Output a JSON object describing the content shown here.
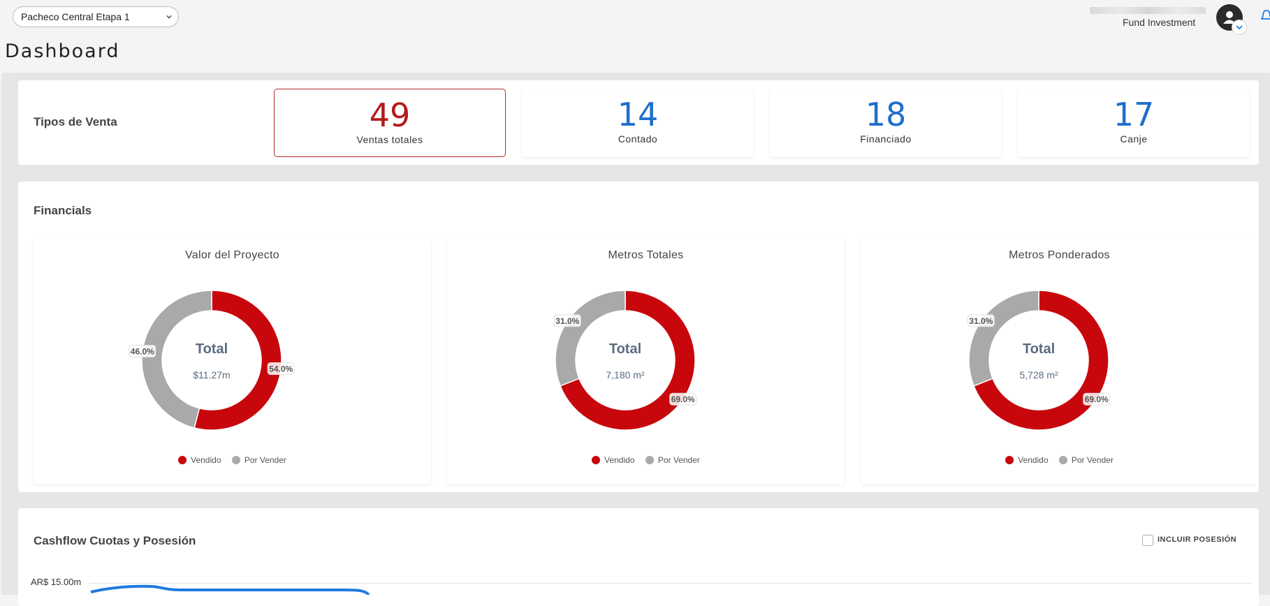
{
  "header": {
    "project_selected": "Pacheco Central Etapa 1",
    "user_role": "Fund Investment",
    "page_title": "Dashboard"
  },
  "ventas": {
    "title": "Tipos de Venta",
    "stats": [
      {
        "value": "49",
        "label": "Ventas totales"
      },
      {
        "value": "14",
        "label": "Contado"
      },
      {
        "value": "18",
        "label": "Financiado"
      },
      {
        "value": "17",
        "label": "Canje"
      }
    ]
  },
  "financials": {
    "title": "Financials",
    "center_label": "Total",
    "legend": {
      "sold": "Vendido",
      "unsold": "Por Vender"
    },
    "colors": {
      "sold": "#c8070d",
      "unsold": "#a9a9a9"
    }
  },
  "chart_data": [
    {
      "type": "pie",
      "title": "Valor del Proyecto",
      "categories": [
        "Vendido",
        "Por Vender"
      ],
      "values": [
        54.0,
        46.0
      ],
      "labels": [
        "54.0%",
        "46.0%"
      ],
      "total": "$11.27m"
    },
    {
      "type": "pie",
      "title": "Metros Totales",
      "categories": [
        "Vendido",
        "Por Vender"
      ],
      "values": [
        69.0,
        31.0
      ],
      "labels": [
        "69.0%",
        "31.0%"
      ],
      "total": "7,180 m²"
    },
    {
      "type": "pie",
      "title": "Metros Ponderados",
      "categories": [
        "Vendido",
        "Por Vender"
      ],
      "values": [
        69.0,
        31.0
      ],
      "labels": [
        "69.0%",
        "31.0%"
      ],
      "total": "5,728 m²"
    },
    {
      "type": "line",
      "title": "Cashflow Cuotas y Posesión",
      "y_tick_labels": [
        "AR$ 15.00m"
      ],
      "series": [
        {
          "values": []
        }
      ]
    }
  ],
  "cashflow": {
    "title": "Cashflow Cuotas y Posesión",
    "include_label": "INCLUIR POSESIÓN",
    "include_checked": false,
    "y_tick_top": "AR$ 15.00m",
    "line_color": "#1e7be0"
  }
}
